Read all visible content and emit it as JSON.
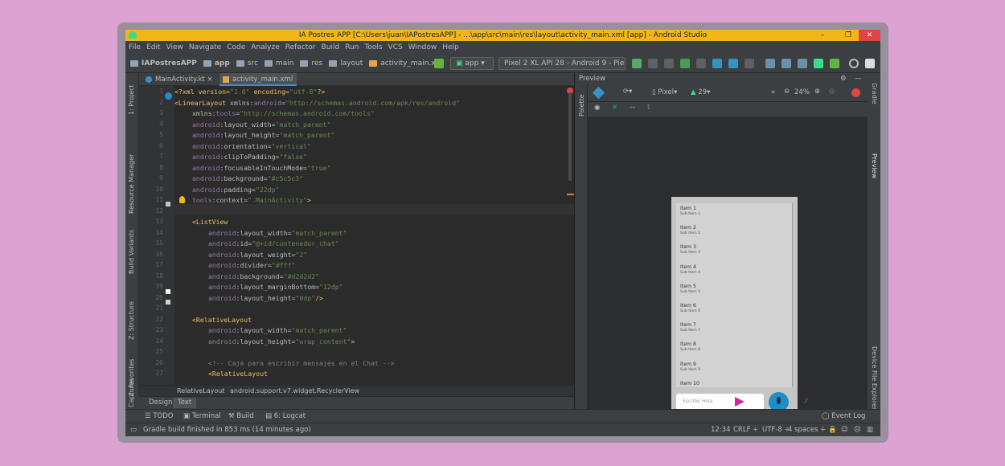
{
  "window": {
    "title": "IA Postres APP [C:\\Users\\juan\\IAPostresAPP] - ...\\app\\src\\main\\res\\layout\\activity_main.xml [app] - Android Studio",
    "minimize": "–",
    "maximize": "❐",
    "close": "✕"
  },
  "menu": [
    "File",
    "Edit",
    "View",
    "Navigate",
    "Code",
    "Analyze",
    "Refactor",
    "Build",
    "Run",
    "Tools",
    "VCS",
    "Window",
    "Help"
  ],
  "breadcrumbs": [
    "IAPostresAPP",
    "app",
    "src",
    "main",
    "res",
    "layout",
    "activity_main.xml"
  ],
  "toolbar": {
    "module": "app",
    "device": "Pixel 2 XL API 28 - Android 9 - Pie"
  },
  "left_tabs": [
    "1: Project",
    "Resource Manager",
    "Build Variants",
    "Z: Structure",
    "2: Favorites",
    "Captures"
  ],
  "right_tabs": [
    "Gradle",
    "Preview",
    "Device File Explorer"
  ],
  "file_tabs": [
    {
      "label": "MainActivity.kt",
      "active": false
    },
    {
      "label": "activity_main.xml",
      "active": true
    }
  ],
  "line_numbers": [
    "1",
    "2",
    "3",
    "4",
    "5",
    "6",
    "7",
    "8",
    "9",
    "10",
    "11",
    "12",
    "13",
    "14",
    "15",
    "16",
    "17",
    "18",
    "19",
    "20",
    "21",
    "22",
    "23",
    "24",
    "25",
    "26",
    "27"
  ],
  "code": {
    "l1": [
      "<?xml version=",
      "\"1.0\"",
      " encoding=",
      "\"utf-8\"",
      "?>"
    ],
    "l2": [
      "<LinearLayout ",
      "xmlns:",
      "android",
      "=",
      "\"http://schemas.android.com/apk/res/android\""
    ],
    "l3": [
      "xmlns:",
      "tools",
      "=",
      "\"http://schemas.android.com/tools\""
    ],
    "l4": [
      "android",
      ":layout_width=",
      "\"match_parent\""
    ],
    "l5": [
      "android",
      ":layout_height=",
      "\"match_parent\""
    ],
    "l6": [
      "android",
      ":orientation=",
      "\"vertical\""
    ],
    "l7": [
      "android",
      ":clipToPadding=",
      "\"false\""
    ],
    "l8": [
      "android",
      ":focusableInTouchMode=",
      "\"true\""
    ],
    "l9": [
      "android",
      ":background=",
      "\"#c5c5c3\""
    ],
    "l10": [
      "android",
      ":padding=",
      "\"22dp\""
    ],
    "l11": [
      "tools",
      ":context=",
      "\".MainActivity\"",
      ">"
    ],
    "l13": [
      "<ListView"
    ],
    "l14": [
      "android",
      ":layout_width=",
      "\"match_parent\""
    ],
    "l15": [
      "android",
      ":id=",
      "\"@+id/contenedor_chat\""
    ],
    "l16": [
      "android",
      ":layout_weight=",
      "\"2\""
    ],
    "l17": [
      "android",
      ":divider=",
      "\"#fff\""
    ],
    "l18": [
      "android",
      ":background=",
      "\"#d2d2d2\""
    ],
    "l19": [
      "android",
      ":layout_marginBottom=",
      "\"12dp\""
    ],
    "l20": [
      "android",
      ":layout_height=",
      "\"0dp\"",
      "/>"
    ],
    "l22": [
      "<RelativeLayout"
    ],
    "l23": [
      "android",
      ":layout_width=",
      "\"match_parent\""
    ],
    "l24": [
      "android",
      ":layout_height=",
      "\"wrap_content\"",
      ">"
    ],
    "l26": [
      "<!-- Caja para escribir mensajes en el Chat -->"
    ],
    "l27": [
      "<RelativeLayout"
    ]
  },
  "editor_breadcrumb": [
    "RelativeLayout",
    "android.support.v7.widget.RecyclerView"
  ],
  "mode_tabs": [
    "Design",
    "Text"
  ],
  "preview": {
    "header": "Preview",
    "palette_label": "Palette",
    "device": "Pixel",
    "api": "29",
    "zoom": "24%",
    "list_items": [
      {
        "title": "Item 1",
        "sub": "Sub Item 1"
      },
      {
        "title": "Item 2",
        "sub": "Sub Item 2"
      },
      {
        "title": "Item 3",
        "sub": "Sub Item 3"
      },
      {
        "title": "Item 4",
        "sub": "Sub Item 4"
      },
      {
        "title": "Item 5",
        "sub": "Sub Item 5"
      },
      {
        "title": "Item 6",
        "sub": "Sub Item 6"
      },
      {
        "title": "Item 7",
        "sub": "Sub Item 7"
      },
      {
        "title": "Item 8",
        "sub": "Sub Item 8"
      },
      {
        "title": "Item 9",
        "sub": "Sub Item 9"
      },
      {
        "title": "Item 10",
        "sub": ""
      }
    ],
    "input_placeholder": "Escribe Hola"
  },
  "bottom_tools": [
    "TODO",
    "Terminal",
    "Build",
    "6: Logcat"
  ],
  "event_log": "Event Log",
  "status": {
    "message": "Gradle build finished in 853 ms (14 minutes ago)",
    "position": "12:34",
    "line_sep": "CRLF ÷",
    "encoding": "UTF-8 ÷",
    "indent": "4 spaces ÷"
  },
  "colors": {
    "titlebar": "#f3b619",
    "accent_green": "#3ddc84",
    "send_arrow": "#d6239a",
    "fab": "#1e8fc6"
  }
}
